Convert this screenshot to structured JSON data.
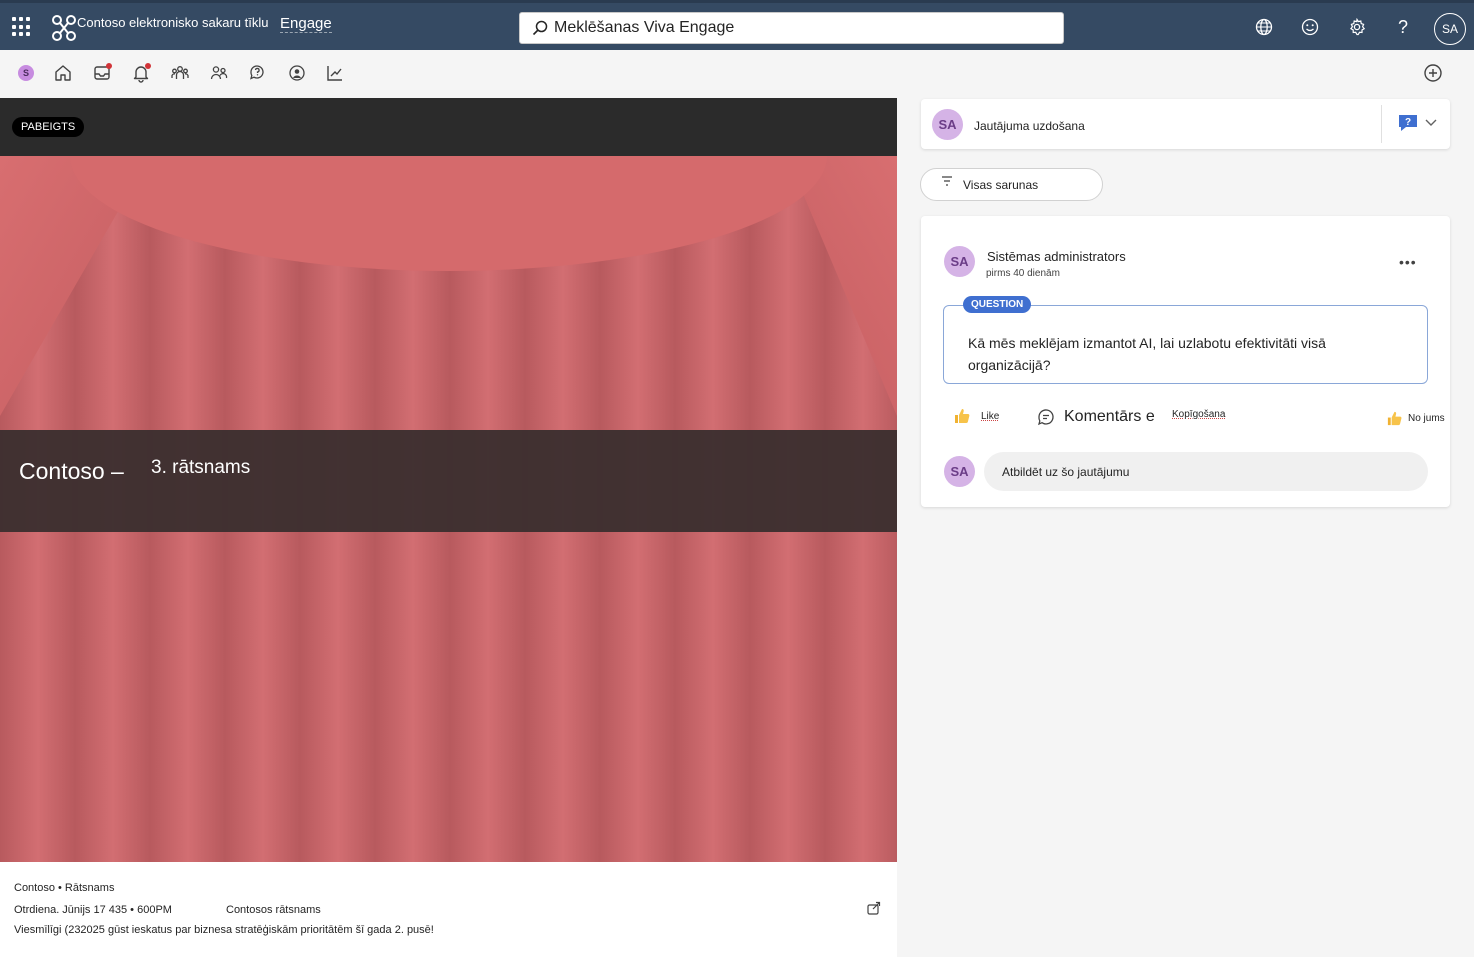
{
  "topbar": {
    "network_name": "Contoso elektronisko sakaru tīklu",
    "app_name": "Engage",
    "search_placeholder": "Meklēšanas Viva Engage",
    "user_initials": "SA"
  },
  "subnav": {
    "community_initial": "S"
  },
  "event": {
    "status": "PABEIGTS",
    "title_prefix": "Contoso –",
    "title": "3. rātsnams",
    "breadcrumb": "Contoso • Rātsnams",
    "datetime": "Otrdiena. Jūnijs 17 435 • 600PM",
    "community": "Contosos rātsnams",
    "description": "Viesmīlīgi (232025 gūst ieskatus par biznesa stratēģiskām prioritātēm šī gada 2. pusē!"
  },
  "ask": {
    "avatar": "SA",
    "label": "Jautājuma uzdošana"
  },
  "filter": {
    "label": "Visas sarunas"
  },
  "post": {
    "author_initials": "SA",
    "author": "Sistēmas administrators",
    "time": "pirms 40 dienām",
    "tag": "QUESTION",
    "question": "Kā mēs meklējam izmantot AI, lai uzlabotu efektivitāti visā organizācijā?",
    "like_label": "Like",
    "comment_label": "Komentārs e",
    "share_label": "Kopīgošana",
    "reaction_label": "No jums",
    "reply_avatar": "SA",
    "reply_placeholder": "Atbildēt uz šo jautājumu"
  }
}
